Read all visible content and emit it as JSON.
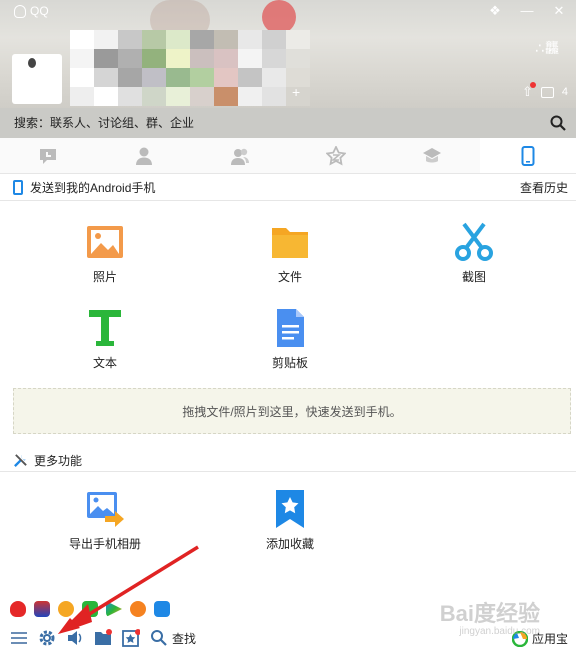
{
  "window": {
    "title": "QQ",
    "controls": {
      "skin": "❖",
      "minimize": "—",
      "close": "✕"
    },
    "status_button": "∴龘",
    "header_badge_count": "4"
  },
  "search": {
    "placeholder": "搜索：联系人、讨论组、群、企业"
  },
  "tabs": [
    {
      "icon": "chat-icon",
      "active": false
    },
    {
      "icon": "contact-icon",
      "active": false
    },
    {
      "icon": "group-icon",
      "active": false
    },
    {
      "icon": "space-icon",
      "active": false
    },
    {
      "icon": "school-icon",
      "active": false
    },
    {
      "icon": "phone-icon",
      "active": true
    }
  ],
  "send": {
    "title": "发送到我的Android手机",
    "history": "查看历史"
  },
  "tools": [
    {
      "label": "照片",
      "icon": "photo-icon"
    },
    {
      "label": "文件",
      "icon": "folder-icon"
    },
    {
      "label": "截图",
      "icon": "scissors-icon"
    },
    {
      "label": "文本",
      "icon": "text-icon"
    },
    {
      "label": "剪贴板",
      "icon": "clipboard-icon"
    }
  ],
  "dropzone": "拖拽文件/照片到这里，快速发送到手机。",
  "more": {
    "title": "更多功能",
    "items": [
      {
        "label": "导出手机相册",
        "icon": "export-album-icon"
      },
      {
        "label": "添加收藏",
        "icon": "favorite-icon"
      }
    ]
  },
  "bottom": {
    "find": "查找",
    "app_store": "应用宝"
  },
  "watermark": {
    "main": "Bai度经验",
    "sub": "jingyan.baidu.com"
  },
  "colors": {
    "accent": "#1e88e5",
    "photo": "#f39a4a",
    "folder": "#f5a623",
    "scissors": "#29a3e0",
    "text": "#2ab63a",
    "arrow": "#e02323"
  }
}
